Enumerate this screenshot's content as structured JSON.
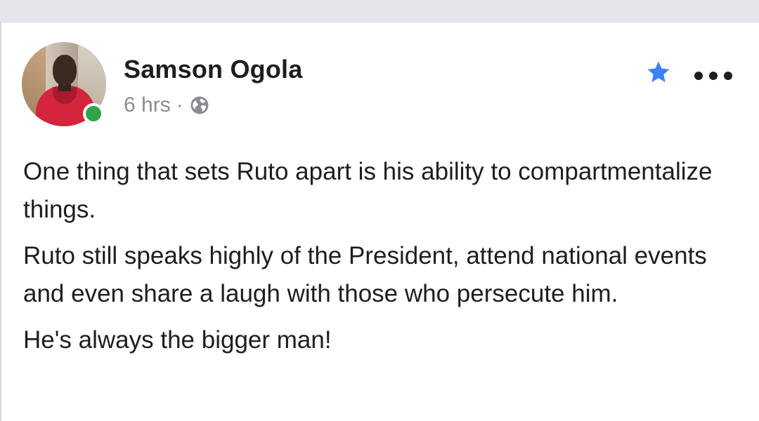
{
  "post": {
    "author": "Samson Ogola",
    "time": "6 hrs",
    "separator": "·",
    "privacy_icon": "globe-icon",
    "favorite_icon": "star-icon",
    "menu_icon": "more-options-icon",
    "online_status": "online",
    "paragraphs": [
      "One thing that sets Ruto apart is his ability to compartmentalize things.",
      "Ruto still speaks highly of the President, attend national events and even share a laugh with those who persecute him.",
      "He's always the bigger man!"
    ]
  },
  "colors": {
    "star": "#3b82f6",
    "online": "#31a24c",
    "text": "#1c1e21",
    "meta": "#8a8d91"
  }
}
